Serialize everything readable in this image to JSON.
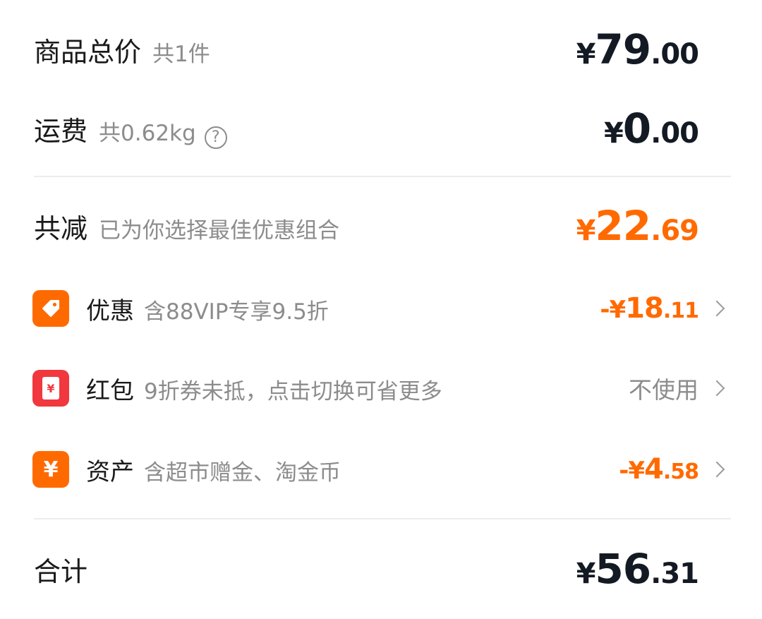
{
  "colors": {
    "accent_orange": "#ff6a00",
    "red_packet": "#f0383e",
    "text_dark": "#141a24",
    "text_gray": "#8c8c8c"
  },
  "goods_total": {
    "label": "商品总价",
    "count": "共1件",
    "symbol": "¥",
    "int": "79",
    "dec": ".00"
  },
  "shipping": {
    "label": "运费",
    "weight": "共0.62kg",
    "help_icon": "question-circle-icon",
    "help_glyph": "?",
    "symbol": "¥",
    "int": "0",
    "dec": ".00"
  },
  "total_discount": {
    "label": "共减",
    "desc": "已为你选择最佳优惠组合",
    "symbol": "¥",
    "int": "22",
    "dec": ".69"
  },
  "discounts": [
    {
      "icon": "coupon-tag-icon",
      "label": "优惠",
      "desc": "含88VIP专享9.5折",
      "prefix": "-¥",
      "int": "18",
      "dec": ".11"
    },
    {
      "icon": "red-packet-icon",
      "icon_glyph": "¥",
      "label": "红包",
      "desc": "9折券未抵，点击切换可省更多",
      "value": "不使用"
    },
    {
      "icon": "yuan-coin-icon",
      "icon_glyph": "¥",
      "label": "资产",
      "desc": "含超市赠金、淘金币",
      "prefix": "-¥",
      "int": "4",
      "dec": ".58"
    }
  ],
  "grand_total": {
    "label": "合计",
    "symbol": "¥",
    "int": "56",
    "dec": ".31"
  }
}
